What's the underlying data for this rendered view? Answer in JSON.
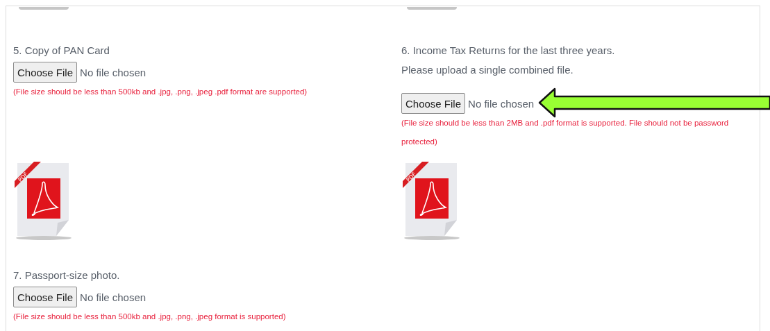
{
  "fields": [
    {
      "title": "5. Copy of PAN Card",
      "button": "Choose File",
      "status": "No file chosen",
      "note": "(File size should be less than 500kb and .jpg, .png, .jpeg .pdf format are supported)",
      "preview": {
        "kind": "pdf",
        "badge": "PDF"
      }
    },
    {
      "title": "6. Income Tax Returns for the last three years.",
      "hint": "Please upload a single combined file.",
      "button": "Choose File",
      "status": "No file chosen",
      "note": "(File size should be less than 2MB and .pdf format is supported. File should not be password protected)",
      "preview": {
        "kind": "pdf",
        "badge": "PDF"
      }
    },
    {
      "title": "7. Passport-size photo.",
      "button": "Choose File",
      "status": "No file chosen",
      "note": "(File size should be less than 500kb and .jpg, .png, .jpeg format is supported)"
    }
  ]
}
